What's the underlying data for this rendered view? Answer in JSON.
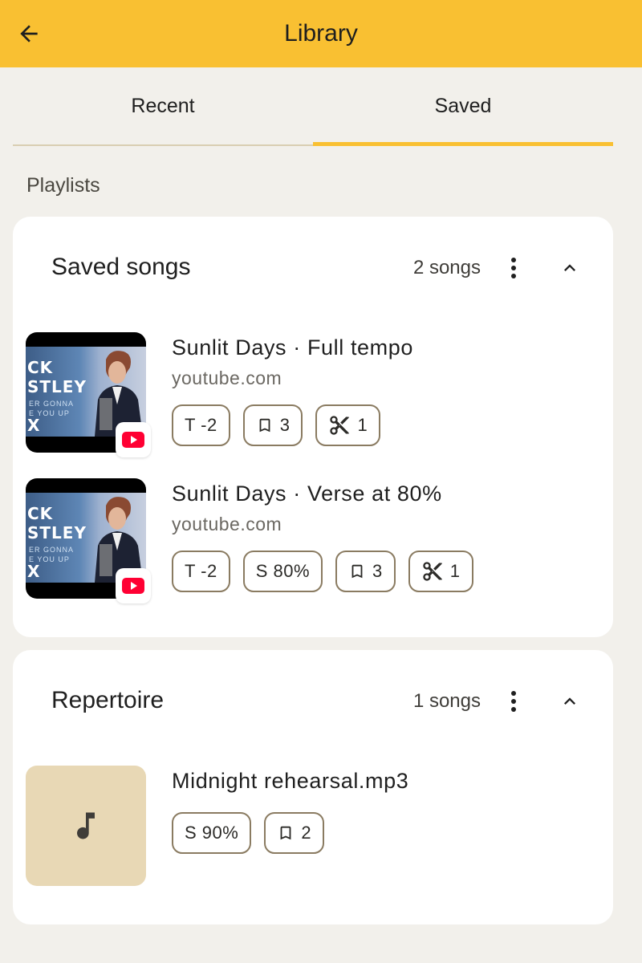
{
  "appbar": {
    "title": "Library",
    "back_icon": "arrow-back-icon",
    "color": "#f9c032"
  },
  "tabs": [
    {
      "label": "Recent",
      "active": false
    },
    {
      "label": "Saved",
      "active": true
    }
  ],
  "section_label": "Playlists",
  "playlists": [
    {
      "title": "Saved songs",
      "count": "2 songs",
      "menu_icon": "more-vert-icon",
      "collapse_icon": "chevron-up-icon",
      "songs": [
        {
          "title": "Sunlit Days · Full tempo",
          "source": "youtube.com",
          "thumbnail": "youtube-video-thumbnail",
          "thumb_text": [
            "CK",
            "STLEY",
            "ER GONNA",
            "E YOU UP",
            "X"
          ],
          "chips": [
            {
              "text": "T -2"
            },
            {
              "icon": "bookmark-icon",
              "text": "3"
            },
            {
              "icon": "scissors-icon",
              "text": "1"
            }
          ]
        },
        {
          "title": "Sunlit Days · Verse at 80%",
          "source": "youtube.com",
          "thumbnail": "youtube-video-thumbnail",
          "thumb_text": [
            "CK",
            "STLEY",
            "ER GONNA",
            "E YOU UP",
            "X"
          ],
          "chips": [
            {
              "text": "T -2"
            },
            {
              "text": "S 80%"
            },
            {
              "icon": "bookmark-icon",
              "text": "3"
            },
            {
              "icon": "scissors-icon",
              "text": "1"
            }
          ]
        }
      ]
    },
    {
      "title": "Repertoire",
      "count": "1 songs",
      "menu_icon": "more-vert-icon",
      "collapse_icon": "chevron-up-icon",
      "songs": [
        {
          "title": "Midnight rehearsal.mp3",
          "thumbnail": "music-note-icon",
          "chips": [
            {
              "text": "S 90%"
            },
            {
              "icon": "bookmark-icon",
              "text": "2"
            }
          ]
        }
      ]
    }
  ]
}
